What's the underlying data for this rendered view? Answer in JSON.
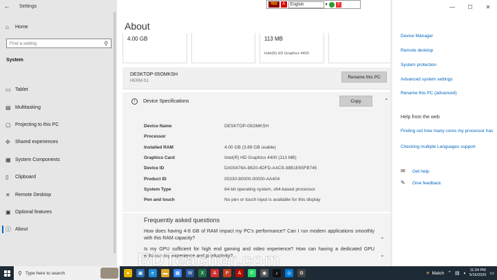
{
  "window": {
    "app_title": "Settings",
    "controls": [
      "—",
      "☐",
      "✕"
    ]
  },
  "sidebar": {
    "home_label": "Home",
    "search_placeholder": "Find a setting",
    "section_label": "System",
    "items": [
      {
        "label": "Tablet",
        "icon": "tablet-icon",
        "glyph": "▭"
      },
      {
        "label": "Multitasking",
        "icon": "multitasking-icon",
        "glyph": "▤"
      },
      {
        "label": "Projecting to this PC",
        "icon": "projecting-icon",
        "glyph": "▢"
      },
      {
        "label": "Shared experiences",
        "icon": "shared-experiences-icon",
        "glyph": "✣"
      },
      {
        "label": "System Components",
        "icon": "system-components-icon",
        "glyph": "▦"
      },
      {
        "label": "Clipboard",
        "icon": "clipboard-icon",
        "glyph": "▯"
      },
      {
        "label": "Remote Desktop",
        "icon": "remote-desktop-icon",
        "glyph": "✕"
      },
      {
        "label": "Optional features",
        "icon": "optional-features-icon",
        "glyph": "▣"
      },
      {
        "label": "About",
        "icon": "about-icon",
        "glyph": "ⓘ"
      }
    ]
  },
  "main": {
    "title": "About",
    "cards": [
      {
        "big": "4.00 GB",
        "small": ""
      },
      {
        "big": "",
        "small": ""
      },
      {
        "big": "113 MB",
        "small": "Intel(R) HD Graphics 4400"
      },
      {
        "big": "",
        "small": ""
      }
    ],
    "pc_name": "DESKTOP-05OMKSH",
    "pc_model": "HERM-S1",
    "rename_button": "Rename this PC",
    "spec_title": "Device Specifications",
    "copy_button": "Copy",
    "specs": [
      {
        "key": "Device Name",
        "value": "DESKTOP-05OMKSH"
      },
      {
        "key": "Processor",
        "value": ""
      },
      {
        "key": "Installed RAM",
        "value": "4.00 GB (3.89 GB usable)"
      },
      {
        "key": "Graphics Card",
        "value": "Intel(R) HD Graphics 4400 (113 MB)"
      },
      {
        "key": "Device ID",
        "value": "DA00478A-8820-4DFD-AAC9-38B1E65FB745"
      },
      {
        "key": "Product ID",
        "value": "00330-80000-00000-AA404"
      },
      {
        "key": "System Type",
        "value": "64-bit operating system, x64-based processor"
      },
      {
        "key": "Pen and touch",
        "value": "No pen or touch input is available for this display"
      }
    ],
    "faq_title": "Frequently asked questions",
    "faqs": [
      "How does having 4-8 GB of RAM impact my PC's performance? Can I run modern applications smoothly with this RAM capacity?",
      "Is my GPU sufficient for high end gaming and video experience? How can having a dedicated GPU enhance my experience and productivity?"
    ]
  },
  "right_pane": {
    "links_top": [
      "Device Manager",
      "Remote desktop",
      "System protection",
      "Advanced system settings",
      "Rename this PC (advanced)"
    ],
    "web_heading": "Help from the web",
    "web_links": [
      "Finding out how many cores my processor has",
      "Checking multiple Languages support"
    ],
    "help_links": [
      {
        "label": "Get help",
        "icon": "get-help-icon"
      },
      {
        "label": "Give feedback",
        "icon": "give-feedback-icon"
      }
    ]
  },
  "language_bar": {
    "brand": "অভ্র",
    "language": "English"
  },
  "watermark": "BDTeacher.com",
  "taskbar": {
    "search_placeholder": "Type here to search",
    "weather_label": "Match",
    "time": "11:34 PM",
    "date": "5/16/2025",
    "app_icons": [
      {
        "name": "chrome-icon",
        "color": "#e8b400",
        "glyph": "●"
      },
      {
        "name": "task-view-icon",
        "color": "#2b6cb0",
        "glyph": "▣"
      },
      {
        "name": "edge-icon",
        "color": "#1f8ad6",
        "glyph": "e"
      },
      {
        "name": "file-explorer-icon",
        "color": "#e0a526",
        "glyph": "▬"
      },
      {
        "name": "store-icon",
        "color": "#3b82f6",
        "glyph": "▦"
      },
      {
        "name": "word-icon",
        "color": "#2b579a",
        "glyph": "W"
      },
      {
        "name": "excel-icon",
        "color": "#1e7145",
        "glyph": "X"
      },
      {
        "name": "pdf-icon",
        "color": "#d32f2f",
        "glyph": "A"
      },
      {
        "name": "powerpoint-icon",
        "color": "#c43e1c",
        "glyph": "P"
      },
      {
        "name": "acrobat-icon",
        "color": "#b30b00",
        "glyph": "A"
      },
      {
        "name": "whatsapp-icon",
        "color": "#25d366",
        "glyph": "✆"
      },
      {
        "name": "vpn-icon",
        "color": "#555555",
        "glyph": "◉"
      },
      {
        "name": "tiktok-icon",
        "color": "#111111",
        "glyph": "♪"
      },
      {
        "name": "tool-icon",
        "color": "#0078d4",
        "glyph": "◎"
      },
      {
        "name": "settings-icon",
        "color": "#444444",
        "glyph": "⚙"
      }
    ]
  }
}
